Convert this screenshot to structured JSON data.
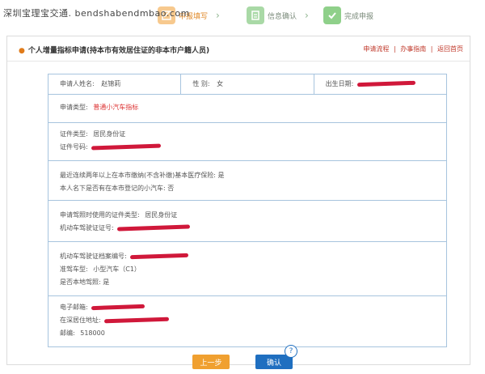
{
  "watermark": "深圳宝理宝交通. bendshabendmbao.com",
  "steps": [
    {
      "label": "申报填写",
      "icon": "form-edit-icon"
    },
    {
      "label": "信息确认",
      "icon": "document-check-icon"
    },
    {
      "label": "完成申报",
      "icon": "checkmark-icon"
    }
  ],
  "panel": {
    "title": "个人增量指标申请(持本市有效居住证的非本市户籍人员)",
    "links": [
      "申请流程",
      "办事指南",
      "返回首页"
    ],
    "link_separator": "|"
  },
  "form": {
    "applicant_name_label": "申请人姓名:",
    "applicant_name": "赵锦莉",
    "gender_label": "性 别:",
    "gender": "女",
    "birth_label": "出生日期:",
    "type_label": "申请类型:",
    "type_value": "普通小汽车指标",
    "id_type_label": "证件类型:",
    "id_type": "居民身份证",
    "id_no_label": "证件号码:",
    "insurance_text": "最近连续两年以上在本市缴纳(不含补缴)基本医疗保险:",
    "insurance_value": "是",
    "car_text": "本人名下是否有在本市登记的小汽车:",
    "car_value": "否",
    "license_id_type_label": "申请驾照时使用的证件类型:",
    "license_id_type": "居民身份证",
    "license_no_label": "机动车驾驶证证号:",
    "archive_label": "机动车驾驶证档案编号:",
    "drive_type_label": "准驾车型:",
    "drive_type": "小型汽车（C1）",
    "local_license_label": "是否本地驾照:",
    "local_license": "是",
    "email_label": "电子邮箱:",
    "address_label": "在深居住地址:",
    "postcode_label": "邮编:",
    "postcode": "518000"
  },
  "buttons": {
    "prev": "上一步",
    "confirm": "确认"
  },
  "colors": {
    "border": "#a7c4de",
    "accent_red": "#d33333",
    "prev_btn": "#f0a030",
    "confirm_btn": "#1f6fc0",
    "redaction": "#d0183a"
  }
}
